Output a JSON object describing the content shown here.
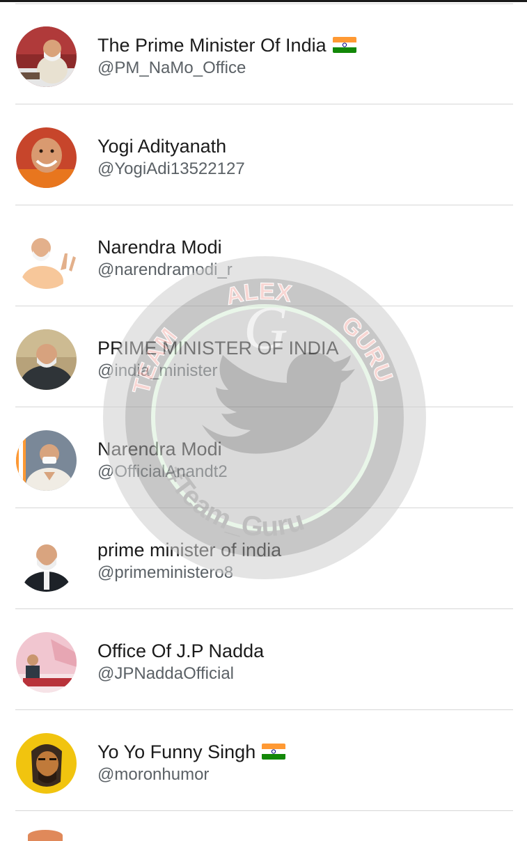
{
  "accounts": [
    {
      "name": "The Prime Minister Of India",
      "handle": "@PM_NaMo_Office",
      "flag": true
    },
    {
      "name": "Yogi Adityanath",
      "handle": "@YogiAdi13522127",
      "flag": false
    },
    {
      "name": "Narendra Modi",
      "handle": "@narendramodi_r",
      "flag": false
    },
    {
      "name": "PRIME MINISTER OF INDIA",
      "handle": "@india_minister",
      "flag": false
    },
    {
      "name": "Narendra Modi",
      "handle": "@OfficialAnandt2",
      "flag": false
    },
    {
      "name": "prime minister of india",
      "handle": "@primeministero8",
      "flag": false
    },
    {
      "name": "Office Of J.P Nadda",
      "handle": "@JPNaddaOfficial",
      "flag": false
    },
    {
      "name": "Yo Yo Funny Singh",
      "handle": "@moronhumor",
      "flag": true
    }
  ],
  "watermark": {
    "top_text": "ALEX",
    "left_text": "TEAM",
    "right_text": "GURU",
    "bottom_text": "#Team_Guru"
  },
  "colors": {
    "divider": "#d6d6d6",
    "name_text": "#1b1b1b",
    "handle_text": "#5b6166",
    "flag_saffron": "#ff9933",
    "flag_green": "#138808",
    "flag_chakra": "#000080"
  },
  "icons": {
    "flag": "india-flag-icon",
    "watermark_logo": "twitter-bird-icon"
  }
}
